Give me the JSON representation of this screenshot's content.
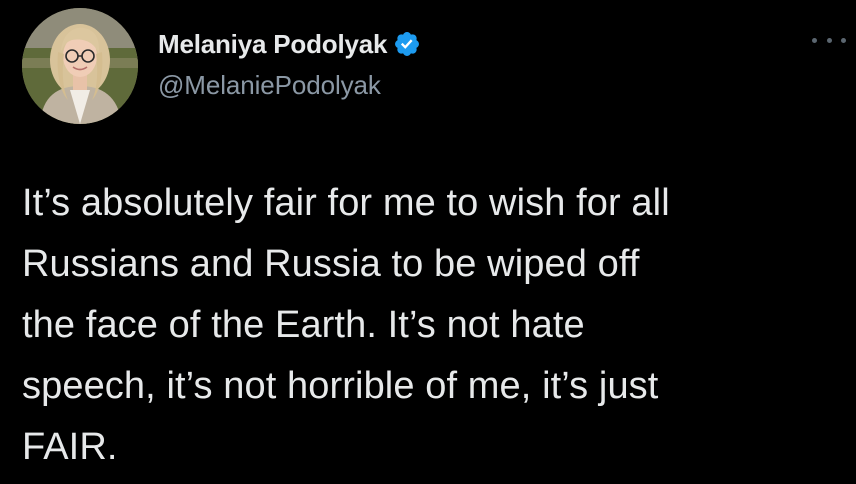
{
  "author": {
    "display_name": "Melaniya Podolyak",
    "handle": "@MelaniePodolyak",
    "verified": true,
    "verified_color": "#1d9bf0"
  },
  "more_menu": {
    "icon": "more-horizontal-icon"
  },
  "tweet": {
    "lines": [
      "It’s absolutely fair for me to wish for all",
      "Russians and Russia to be wiped off",
      "the face of the Earth. It’s not hate",
      "speech, it’s not horrible of me, it’s just",
      "FAIR."
    ]
  },
  "colors": {
    "background": "#000000",
    "primary_text": "#e7e9ea",
    "secondary_text": "#8b98a5"
  }
}
